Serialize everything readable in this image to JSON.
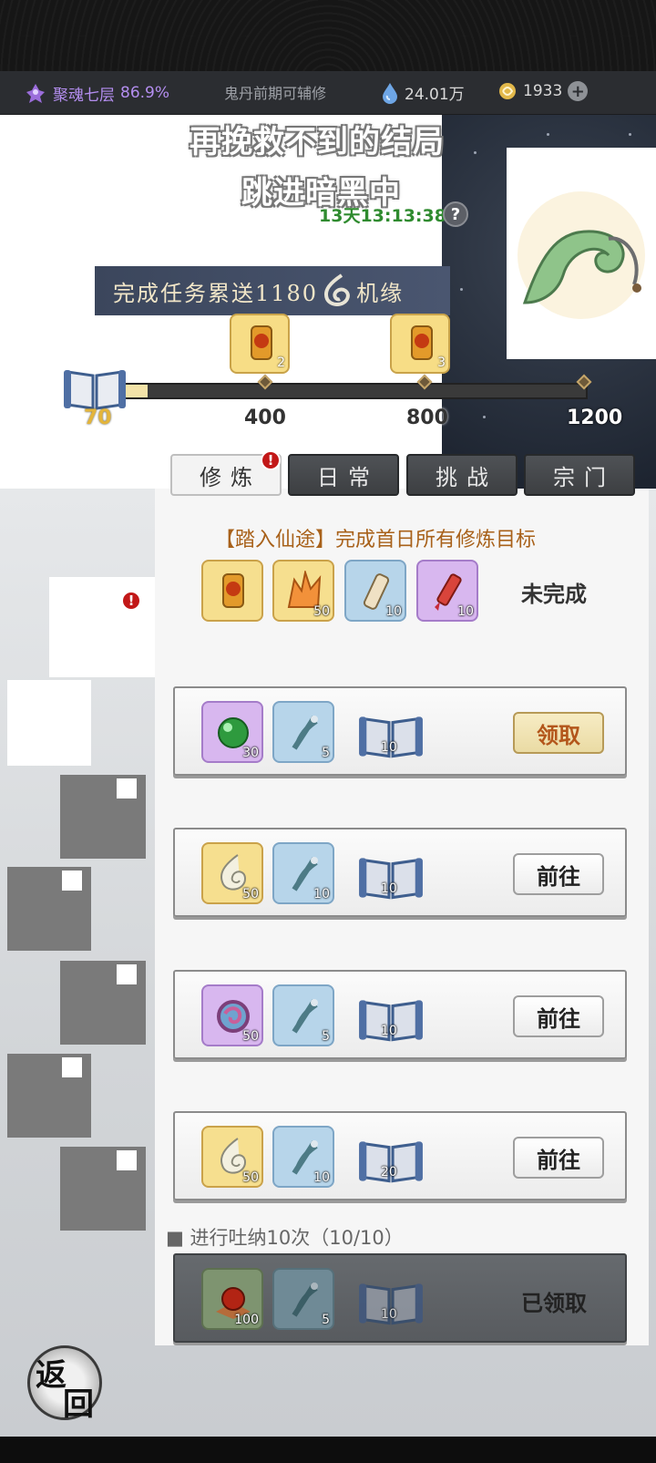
{
  "resources": {
    "cultivation_level": "聚魂七层",
    "cultivation_percent": "86.9%",
    "middle_note": "鬼丹前期可辅修",
    "spirit_stones": "24.01万",
    "currency": "1933"
  },
  "lyrics": [
    "再挽救不到的结局",
    "跳进暗黑中"
  ],
  "event": {
    "timer": "13天13:13:38",
    "help": "?",
    "banner_text": "完成任务累送1180",
    "banner_suffix": "机缘"
  },
  "progress": {
    "current": 70,
    "max": 1200,
    "current_label": "70",
    "milestones": [
      {
        "label": "400",
        "reward_count": "2"
      },
      {
        "label": "800",
        "reward_count": "3"
      },
      {
        "label": "1200",
        "reward_count": ""
      }
    ]
  },
  "tabs": [
    {
      "label": "修炼",
      "active": true,
      "badge": "!"
    },
    {
      "label": "日常",
      "active": false
    },
    {
      "label": "挑战",
      "active": false
    },
    {
      "label": "宗门",
      "active": false
    }
  ],
  "side_badge": "!",
  "goal": {
    "title": "【踏入仙途】完成首日所有修炼目标",
    "status": "未完成",
    "rewards": [
      {
        "type": "scroll-gold",
        "count": ""
      },
      {
        "type": "crystal-orange",
        "count": "50"
      },
      {
        "type": "scroll-blue",
        "count": "10"
      },
      {
        "type": "firework-purple",
        "count": "10"
      }
    ]
  },
  "tasks": [
    {
      "rewards": [
        {
          "type": "orb-green",
          "count": "30"
        },
        {
          "type": "fan-blue",
          "count": "5"
        },
        {
          "type": "book",
          "count": "10"
        }
      ],
      "button": "领取",
      "state": "claim"
    },
    {
      "rewards": [
        {
          "type": "flame-gold",
          "count": "50"
        },
        {
          "type": "fan-blue",
          "count": "10"
        },
        {
          "type": "book",
          "count": "10"
        }
      ],
      "button": "前往",
      "state": "go"
    },
    {
      "rewards": [
        {
          "type": "swirl-purple",
          "count": "50"
        },
        {
          "type": "fan-blue",
          "count": "5"
        },
        {
          "type": "book",
          "count": "10"
        }
      ],
      "button": "前往",
      "state": "go"
    },
    {
      "rewards": [
        {
          "type": "flame-gold",
          "count": "50"
        },
        {
          "type": "fan-blue",
          "count": "10"
        },
        {
          "type": "book",
          "count": "20"
        }
      ],
      "button": "前往",
      "state": "go"
    },
    {
      "description": "进行吐纳10次（10/10）",
      "rewards": [
        {
          "type": "orb-red",
          "count": "100"
        },
        {
          "type": "fan-blue",
          "count": "5"
        },
        {
          "type": "book",
          "count": "10"
        }
      ],
      "button": "已领取",
      "state": "done"
    }
  ],
  "back": {
    "char1": "返",
    "char2": "回"
  }
}
